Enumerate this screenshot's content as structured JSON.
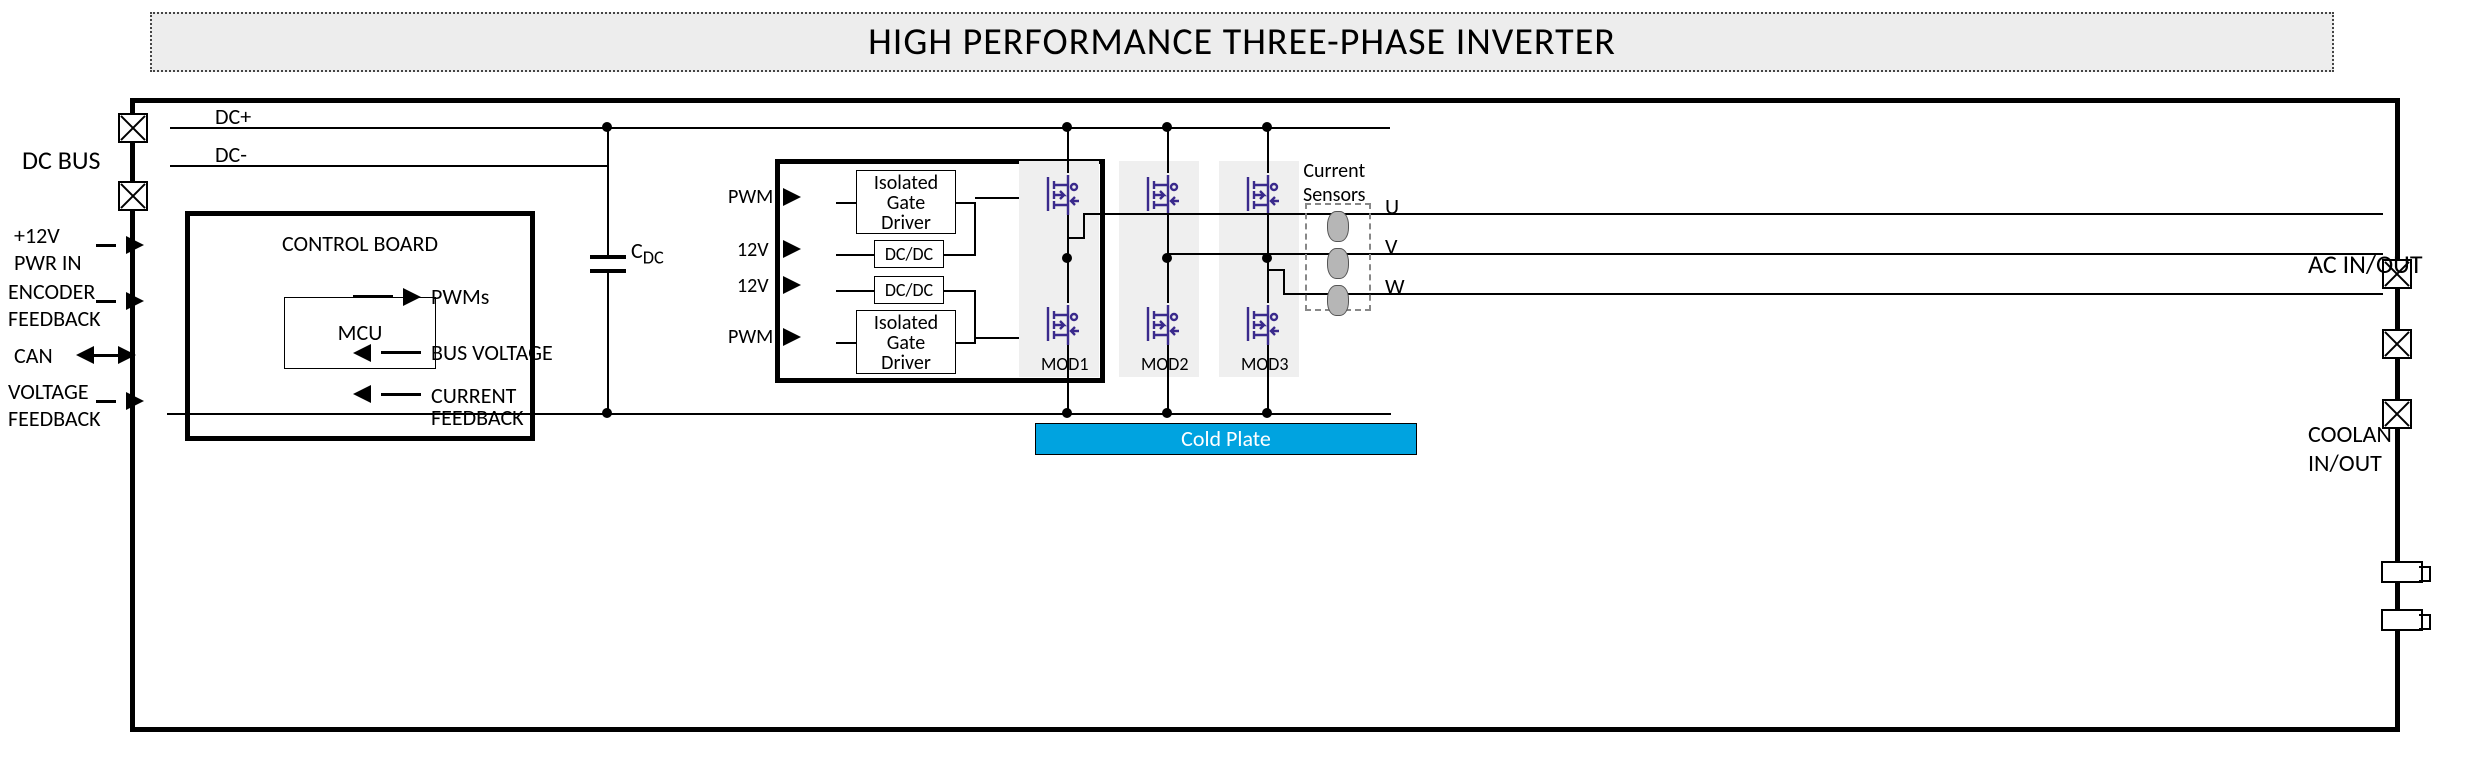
{
  "title": "HIGH PERFORMANCE THREE-PHASE INVERTER",
  "external_labels": {
    "dc_bus": "DC BUS",
    "pwr_in": "+12V\nPWR IN",
    "encoder": "ENCODER\nFEEDBACK",
    "can": "CAN",
    "vfb": "VOLTAGE\nFEEDBACK",
    "ac_inout": "AC IN/OUT",
    "coolant": "COOLANT\nIN/OUT"
  },
  "bus": {
    "dcp": "DC+",
    "dcn": "DC-"
  },
  "control_board": {
    "title": "CONTROL BOARD",
    "mcu": "MCU",
    "out_pwm": "PWMs",
    "in_busv": "BUS VOLTAGE",
    "in_curfb": "CURRENT\nFEEDBACK"
  },
  "cap_label": "C",
  "cap_sub": "DC",
  "driver": {
    "pwm": "PWM",
    "v12": "12V",
    "iso_gate": "Isolated\nGate\nDriver",
    "dcdc": "DC/DC"
  },
  "modules": {
    "m1": "MOD1",
    "m2": "MOD2",
    "m3": "MOD3"
  },
  "current_sensors_title": "Current\nSensors",
  "phases": {
    "u": "U",
    "v": "V",
    "w": "W"
  },
  "cold_plate": "Cold Plate"
}
